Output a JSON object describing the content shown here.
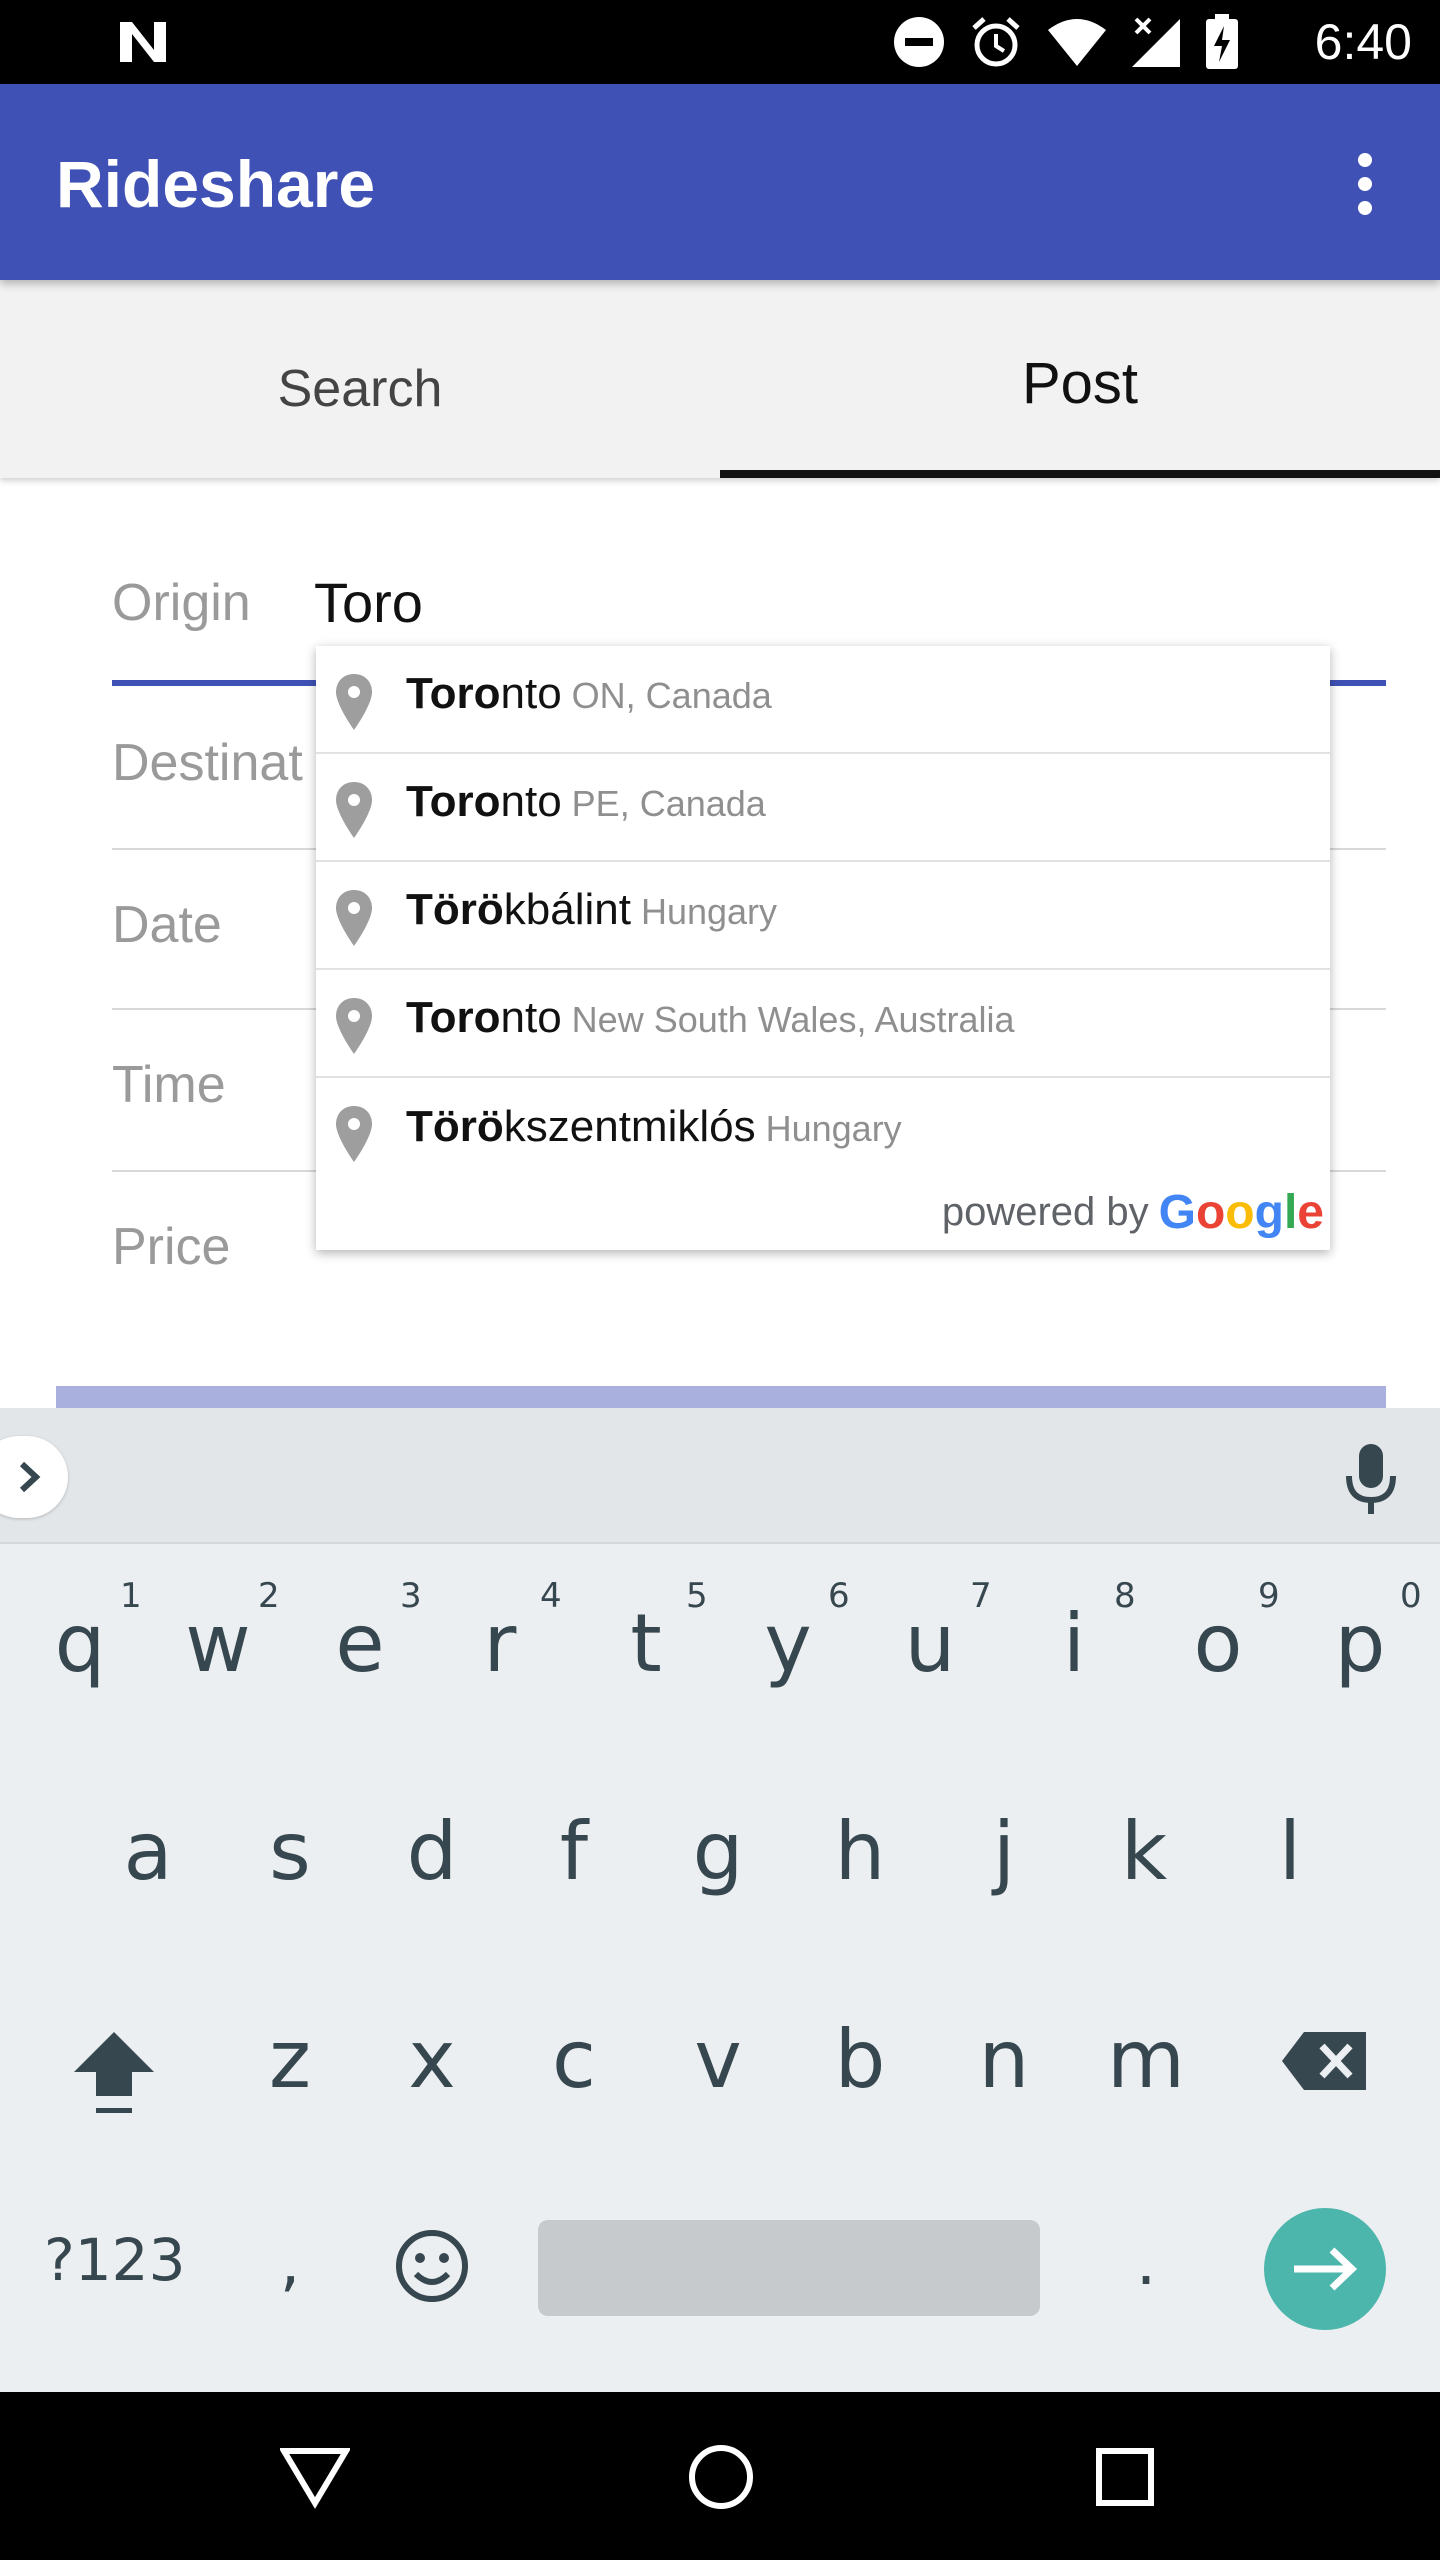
{
  "status_bar": {
    "time": "6:40",
    "icons": [
      "n-logo-icon",
      "do-not-disturb-icon",
      "alarm-icon",
      "wifi-icon",
      "signal-icon",
      "battery-charging-icon"
    ]
  },
  "app_bar": {
    "title": "Rideshare",
    "overflow_icon": "more-vert-icon"
  },
  "tabs": [
    {
      "label": "Search",
      "selected": false
    },
    {
      "label": "Post",
      "selected": true
    }
  ],
  "form": {
    "origin_label": "Origin",
    "origin_value": "Toro",
    "destination_label": "Destinat",
    "date_label": "Date",
    "time_label": "Time",
    "price_label": "Price"
  },
  "suggestions": [
    {
      "match": "Toro",
      "rest": "nto",
      "secondary": "ON, Canada"
    },
    {
      "match": "Toro",
      "rest": "nto",
      "secondary": "PE, Canada"
    },
    {
      "match": "Törö",
      "rest": "kbálint",
      "secondary": "Hungary"
    },
    {
      "match": "Toro",
      "rest": "nto",
      "secondary": "New South Wales, Australia"
    },
    {
      "match": "Törö",
      "rest": "kszentmiklós",
      "secondary": "Hungary"
    }
  ],
  "attribution": {
    "powered_by": "powered by",
    "logo_text": "Google",
    "logo_colors": [
      "#4285F4",
      "#EA4335",
      "#FBBC05",
      "#4285F4",
      "#34A853",
      "#EA4335"
    ]
  },
  "keyboard": {
    "row1": [
      "q",
      "w",
      "e",
      "r",
      "t",
      "y",
      "u",
      "i",
      "o",
      "p"
    ],
    "row1_hints": [
      "1",
      "2",
      "3",
      "4",
      "5",
      "6",
      "7",
      "8",
      "9",
      "0"
    ],
    "row2": [
      "a",
      "s",
      "d",
      "f",
      "g",
      "h",
      "j",
      "k",
      "l"
    ],
    "row3": [
      "z",
      "x",
      "c",
      "v",
      "b",
      "n",
      "m"
    ],
    "symbols_label": "?123",
    "comma": ",",
    "period": ".",
    "icons": [
      "shift-icon",
      "backspace-icon",
      "emoji-icon",
      "enter-arrow-icon",
      "mic-icon",
      "expand-icon"
    ]
  },
  "colors": {
    "primary": "#3f51b5",
    "accent_enter": "#4db6ac",
    "tab_indicator": "#111111"
  }
}
